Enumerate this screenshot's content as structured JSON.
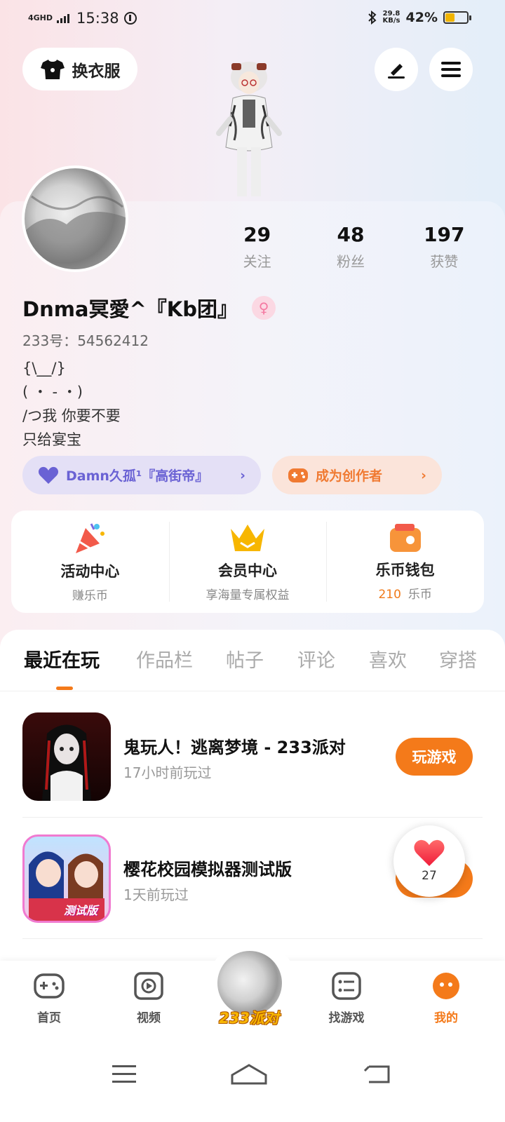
{
  "status_bar": {
    "signal": "4GHD",
    "time": "15:38",
    "net_speed": "29.8",
    "net_unit": "KB/s",
    "battery": "42%",
    "battery_level": 0.42
  },
  "header": {
    "dress_label": "换衣服"
  },
  "profile": {
    "nickname": "Dnma冥愛^『Kb团』",
    "uid_label": "233号：",
    "uid": "54562412",
    "bio": "{\\__/}\n( ・ - ・)\n/つ我 你要不要\n只给宴宝",
    "stats": [
      {
        "value": "29",
        "label": "关注"
      },
      {
        "value": "48",
        "label": "粉丝"
      },
      {
        "value": "197",
        "label": "获赞"
      }
    ],
    "follow_pill": "Damn久孤¹『高街帝』",
    "creator_pill": "成为创作者"
  },
  "quick_entries": [
    {
      "title": "活动中心",
      "sub": "赚乐币"
    },
    {
      "title": "会员中心",
      "sub": "享海量专属权益"
    },
    {
      "title": "乐币钱包",
      "coin": "210",
      "sub": "乐币"
    }
  ],
  "tabs": [
    "最近在玩",
    "作品栏",
    "帖子",
    "评论",
    "喜欢",
    "穿搭"
  ],
  "games": [
    {
      "title": "鬼玩人！逃离梦境 - 233派对",
      "time": "17小时前玩过",
      "button": "玩游戏"
    },
    {
      "title": "樱花校园模拟器测试版",
      "time": "1天前玩过",
      "badge": "测试版"
    }
  ],
  "float_heart": {
    "count": "27"
  },
  "bottom_nav": {
    "items": [
      "首页",
      "视频",
      "233派对",
      "找游戏",
      "我的"
    ]
  },
  "colors": {
    "accent": "#f47a1a",
    "follow": "#6a62d4",
    "gender": "#f47aa2"
  }
}
